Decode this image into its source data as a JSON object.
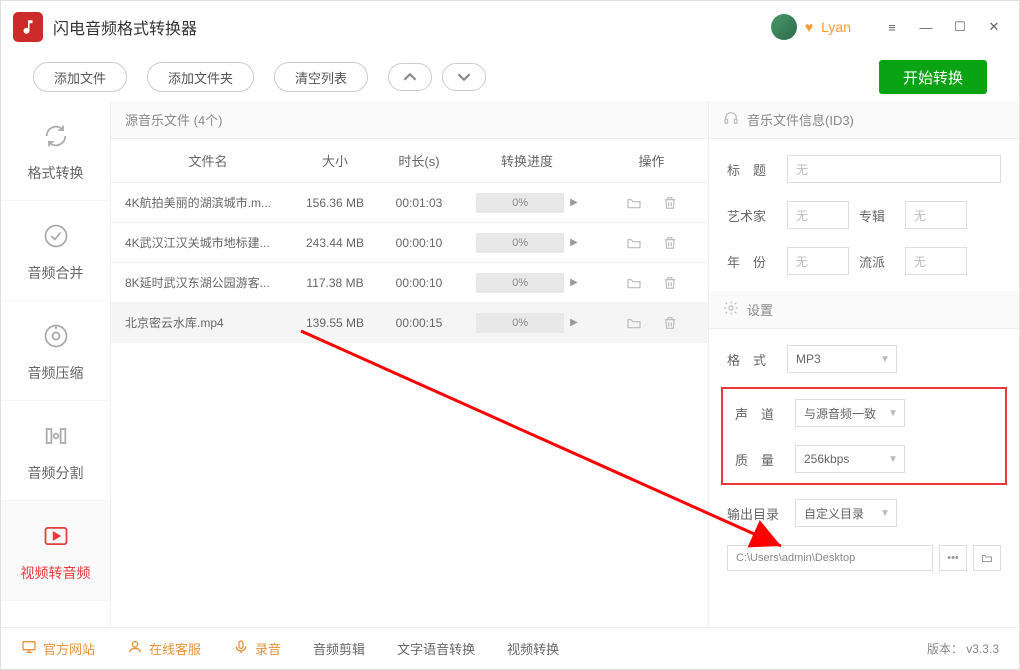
{
  "app": {
    "title": "闪电音频格式转换器",
    "username": "Lyan"
  },
  "toolbar": {
    "add_file": "添加文件",
    "add_folder": "添加文件夹",
    "clear_list": "清空列表",
    "start": "开始转换"
  },
  "sidebar": [
    {
      "label": "格式转换"
    },
    {
      "label": "音频合并"
    },
    {
      "label": "音频压缩"
    },
    {
      "label": "音频分割"
    },
    {
      "label": "视频转音频"
    }
  ],
  "center": {
    "header": "源音乐文件 (4个)",
    "columns": {
      "name": "文件名",
      "size": "大小",
      "dur": "时长(s)",
      "prog": "转换进度",
      "op": "操作"
    },
    "rows": [
      {
        "name": "4K航拍美丽的湖滨城市.m...",
        "size": "156.36 MB",
        "dur": "00:01:03",
        "prog": "0%"
      },
      {
        "name": "4K武汉江汉关城市地标建...",
        "size": "243.44 MB",
        "dur": "00:00:10",
        "prog": "0%"
      },
      {
        "name": "8K延时武汉东湖公园游客...",
        "size": "117.38 MB",
        "dur": "00:00:10",
        "prog": "0%"
      },
      {
        "name": "北京密云水库.mp4",
        "size": "139.55 MB",
        "dur": "00:00:15",
        "prog": "0%"
      }
    ]
  },
  "info": {
    "head": "音乐文件信息(ID3)",
    "title_label": "标　题",
    "title_ph": "无",
    "artist_label": "艺术家",
    "artist_ph": "无",
    "album_label": "专辑",
    "album_ph": "无",
    "year_label": "年　份",
    "year_ph": "无",
    "genre_label": "流派",
    "genre_ph": "无"
  },
  "settings": {
    "head": "设置",
    "format_label": "格　式",
    "format_value": "MP3",
    "channel_label": "声　道",
    "channel_value": "与源音频一致",
    "quality_label": "质　量",
    "quality_value": "256kbps",
    "outdir_label": "输出目录",
    "outdir_value": "自定义目录",
    "path": "C:\\Users\\admin\\Desktop"
  },
  "footer": {
    "site": "官方网站",
    "service": "在线客服",
    "record": "录音",
    "cut": "音频剪辑",
    "tts": "文字语音转换",
    "video": "视频转换",
    "version": "版本： v3.3.3"
  }
}
